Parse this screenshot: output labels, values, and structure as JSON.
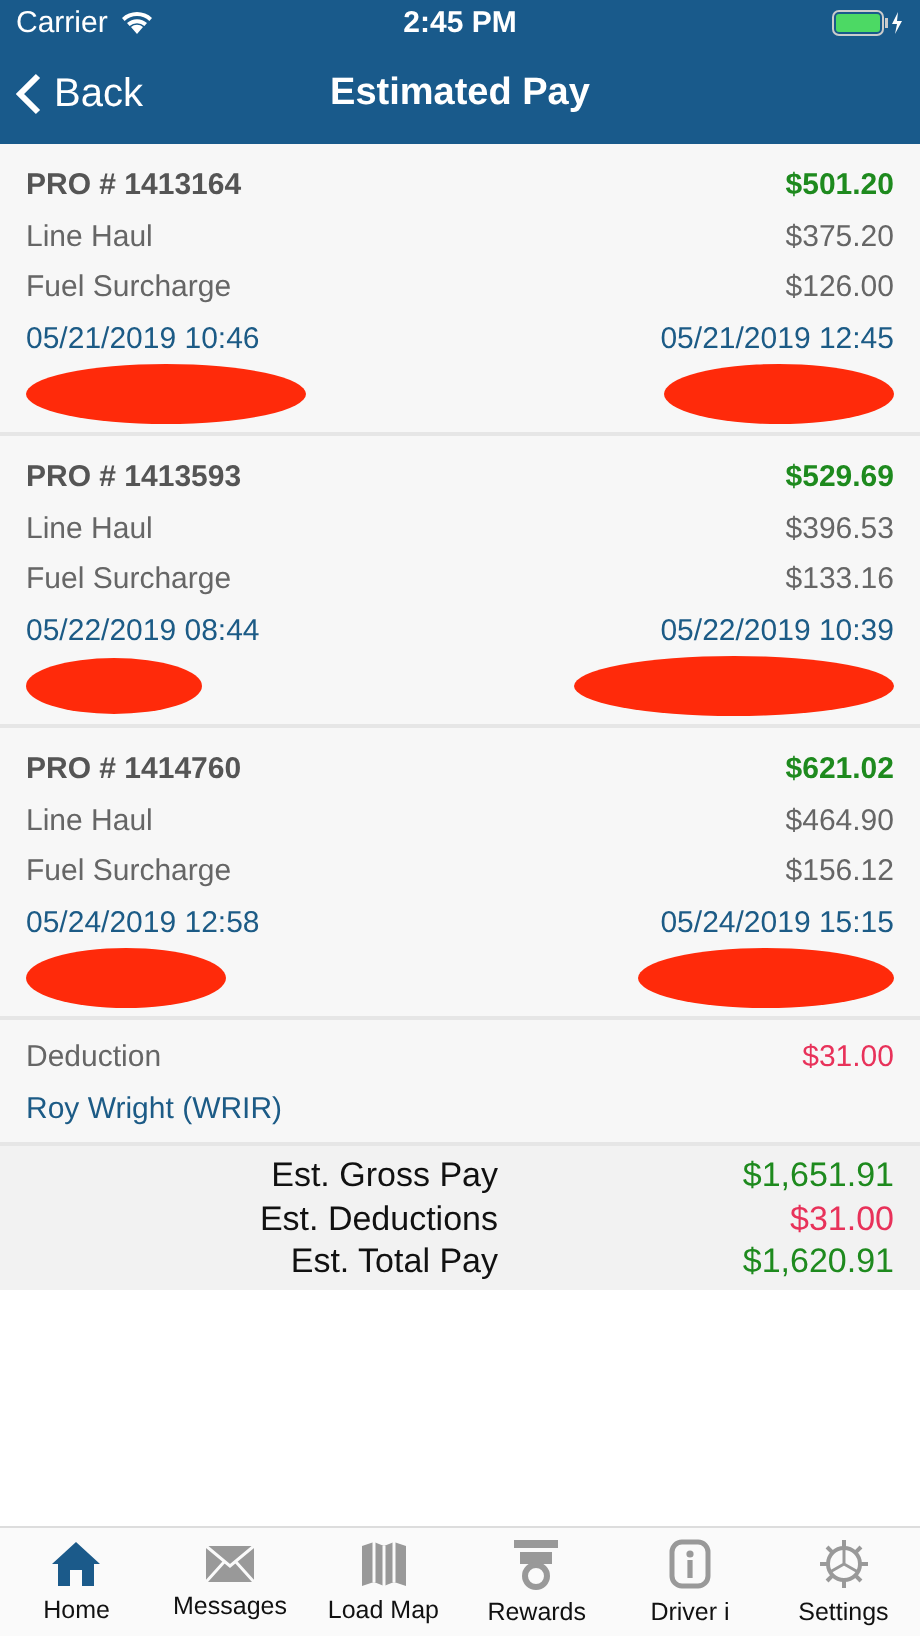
{
  "status_bar": {
    "carrier": "Carrier",
    "time": "2:45 PM"
  },
  "nav": {
    "back": "Back",
    "title": "Estimated Pay"
  },
  "loads": [
    {
      "pro": "PRO # 1413164",
      "total": "$501.20",
      "items": [
        {
          "label": "Line Haul",
          "amount": "$375.20"
        },
        {
          "label": "Fuel Surcharge",
          "amount": "$126.00"
        }
      ],
      "start": "05/21/2019 10:46",
      "end": "05/21/2019 12:45"
    },
    {
      "pro": "PRO # 1413593",
      "total": "$529.69",
      "items": [
        {
          "label": "Line Haul",
          "amount": "$396.53"
        },
        {
          "label": "Fuel Surcharge",
          "amount": "$133.16"
        }
      ],
      "start": "05/22/2019 08:44",
      "end": "05/22/2019 10:39"
    },
    {
      "pro": "PRO # 1414760",
      "total": "$621.02",
      "items": [
        {
          "label": "Line Haul",
          "amount": "$464.90"
        },
        {
          "label": "Fuel Surcharge",
          "amount": "$156.12"
        }
      ],
      "start": "05/24/2019 12:58",
      "end": "05/24/2019 15:15"
    }
  ],
  "deduction": {
    "label": "Deduction",
    "amount": "$31.00",
    "driver": "Roy Wright (WRIR)"
  },
  "totals": [
    {
      "label": "Est. Gross Pay",
      "value": "$1,651.91",
      "kind": "positive"
    },
    {
      "label": "Est. Deductions",
      "value": "$31.00",
      "kind": "negative"
    },
    {
      "label": "Est. Total Pay",
      "value": "$1,620.91",
      "kind": "positive"
    }
  ],
  "tabs": [
    {
      "label": "Home",
      "selected": true
    },
    {
      "label": "Messages",
      "selected": false
    },
    {
      "label": "Load Map",
      "selected": false
    },
    {
      "label": "Rewards",
      "selected": false
    },
    {
      "label": "Driver i",
      "selected": false
    },
    {
      "label": "Settings",
      "selected": false
    }
  ]
}
